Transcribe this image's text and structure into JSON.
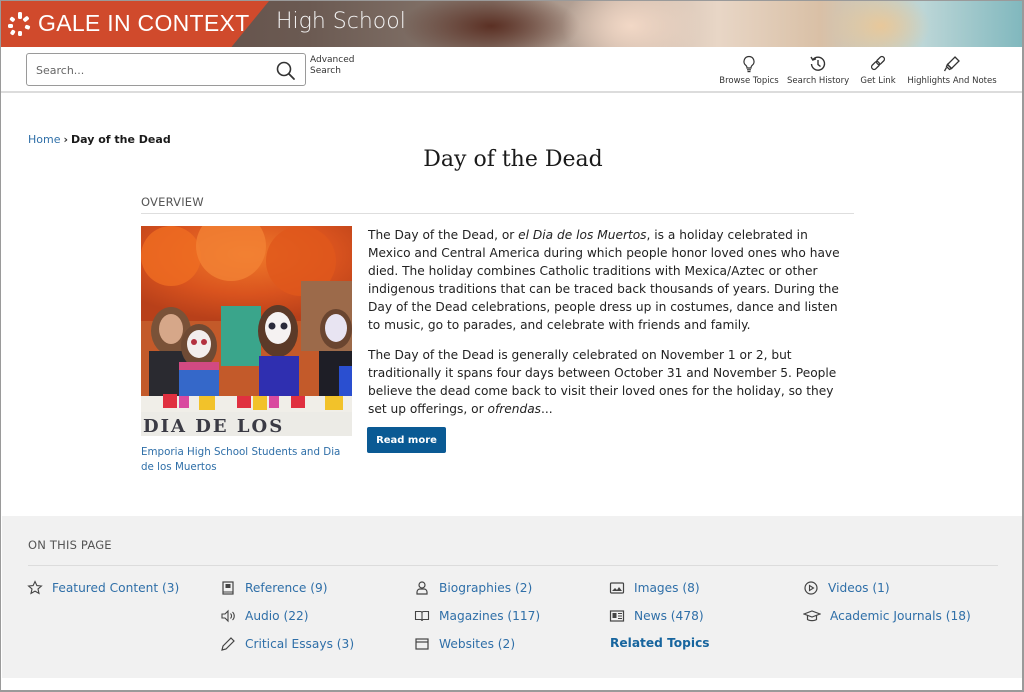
{
  "brand": {
    "logo_text": "GALE IN CONTEXT",
    "product": "High School",
    "accent_color": "#d04a2c"
  },
  "toolbar": {
    "search_placeholder": "Search...",
    "search_value": "",
    "advanced_search_line1": "Advanced",
    "advanced_search_line2": "Search",
    "tools": [
      {
        "label": "Browse Topics",
        "icon": "lightbulb-icon"
      },
      {
        "label": "Search History",
        "icon": "history-icon"
      },
      {
        "label": "Get Link",
        "icon": "link-icon"
      },
      {
        "label": "Highlights And Notes",
        "icon": "highlighter-icon"
      }
    ]
  },
  "breadcrumb": {
    "home": "Home",
    "separator": "›",
    "current": "Day of the Dead"
  },
  "page": {
    "title": "Day of the Dead",
    "overview_heading": "OVERVIEW",
    "image_caption": "Emporia High School Students and Dia de los Muertos",
    "image_banner_text": "DIA  DE  LOS",
    "paragraph1_a": "The Day of the Dead, or ",
    "paragraph1_em": "el Dia de los Muertos",
    "paragraph1_b": ", is a holiday celebrated in Mexico and Central America during which people honor loved ones who have died. The holiday combines Catholic traditions with Mexica/Aztec or other indigenous traditions that can be traced back thousands of years. During the Day of the Dead celebrations, people dress up in costumes, dance and listen to music, go to parades, and celebrate with friends and family.",
    "paragraph2_a": "The Day of the Dead is generally celebrated on November 1 or 2, but traditionally it spans four days between October 31 and November 5. People believe the dead come back to visit their loved ones for the holiday, so they set up offerings, or ",
    "paragraph2_em": "ofrendas",
    "paragraph2_b": "...",
    "read_more": "Read more",
    "button_color": "#0a5a94"
  },
  "on_this_page": {
    "heading": "ON THIS PAGE",
    "items": [
      {
        "label": "Featured Content (3)",
        "icon": "star-icon"
      },
      {
        "label": "Reference (9)",
        "icon": "reference-book-icon"
      },
      {
        "label": "Audio (22)",
        "icon": "speaker-icon"
      },
      {
        "label": "Critical Essays (3)",
        "icon": "pencil-icon"
      },
      {
        "label": "Biographies (2)",
        "icon": "person-icon"
      },
      {
        "label": "Magazines (117)",
        "icon": "open-book-icon"
      },
      {
        "label": "Websites (2)",
        "icon": "browser-window-icon"
      },
      {
        "label": "Images (8)",
        "icon": "image-icon"
      },
      {
        "label": "News (478)",
        "icon": "newspaper-icon"
      },
      {
        "label": "Related Topics",
        "icon": ""
      },
      {
        "label": "Videos (1)",
        "icon": "play-circle-icon"
      },
      {
        "label": "Academic Journals (18)",
        "icon": "graduation-cap-icon"
      }
    ],
    "link_color": "#2f6fa8"
  }
}
